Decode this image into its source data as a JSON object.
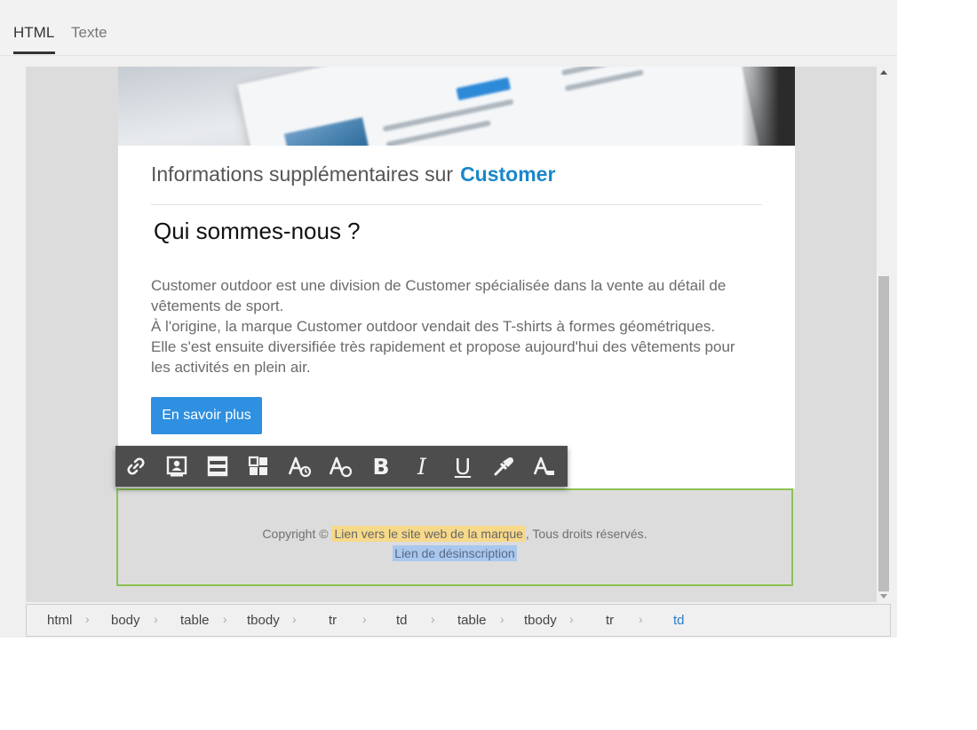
{
  "tabs": {
    "html": "HTML",
    "text": "Texte"
  },
  "email": {
    "subtitle_prefix": "Informations supplémentaires sur",
    "subtitle_brand": "Customer",
    "heading": "Qui sommes-nous ?",
    "body_lines": [
      "Customer outdoor est une division de Customer spécialisée dans la vente au détail de",
      "vêtements de sport.",
      "À l'origine, la marque Customer outdoor vendait des T-shirts à formes géométriques.",
      "Elle s'est ensuite diversifiée très rapidement et propose aujourd'hui des vêtements pour",
      "les activités en plein air."
    ],
    "cta_label": "En savoir plus",
    "footer": {
      "copyright": "Copyright ©",
      "brand_link": "Lien vers le site web de la marque",
      "rights": ", Tous droits réservés.",
      "unsubscribe": "Lien de désinscription"
    }
  },
  "toolbar": {
    "buttons": [
      "link-icon",
      "personalization-icon",
      "fragment-icon",
      "content-block-icon",
      "font-icon",
      "font-size-icon",
      "bold-icon",
      "italic-icon",
      "underline-icon",
      "color-picker-icon",
      "clear-format-icon"
    ],
    "bold_glyph": "B",
    "italic_glyph": "I",
    "underline_glyph": "U"
  },
  "breadcrumb": [
    "html",
    "body",
    "table",
    "tbody",
    "tr",
    "td",
    "table",
    "tbody",
    "tr",
    "td"
  ],
  "colors": {
    "accent": "#1b87c9",
    "cta": "#2f8fe0",
    "selection_border": "#8cc152",
    "highlight_yellow": "#f7d98a",
    "highlight_blue": "#a9c8f0"
  }
}
